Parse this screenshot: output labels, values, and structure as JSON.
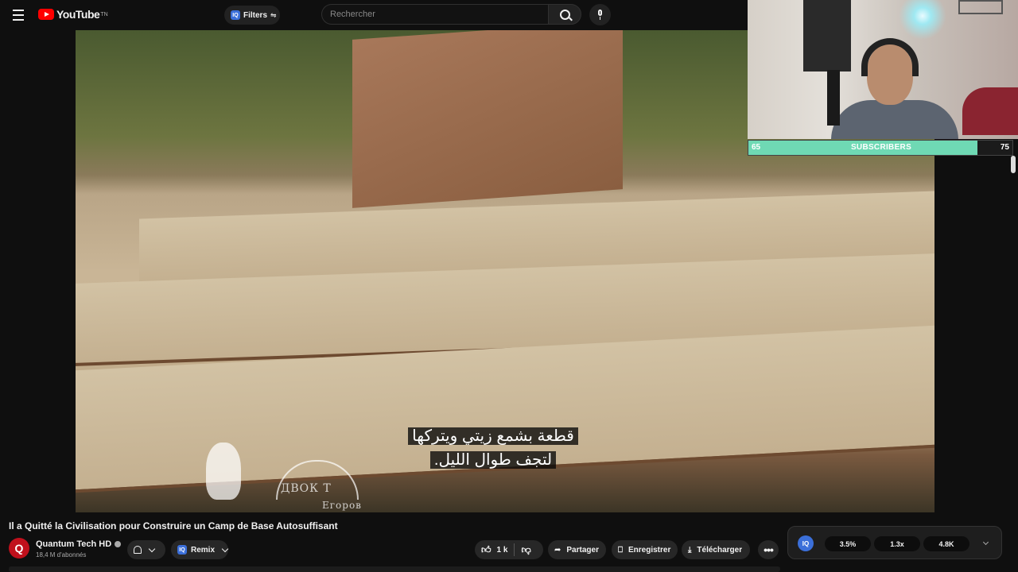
{
  "header": {
    "logo_text": "YouTube",
    "logo_tm": "TN",
    "filters_label": "Filters",
    "filters_badge": "IQ",
    "search_placeholder": "Rechercher"
  },
  "video": {
    "subtitle_line1": "قطعة بشمع زيتي ويتركها",
    "subtitle_line2": "لتجف طوال الليل.",
    "watermark_text": "ДВОК   Т",
    "watermark_name": "Егоров"
  },
  "subscriber_goal": {
    "current": "65",
    "label": "SUBSCRIBERS",
    "target": "75",
    "progress_fraction": 0.867,
    "fill_color": "#6fd9b4"
  },
  "info": {
    "title": "Il a Quitté la Civilisation pour Construire un Camp de Base Autosuffisant",
    "channel_name": "Quantum Tech HD",
    "channel_avatar_letter": "Q",
    "subscribers": "18,4 M d'abonnés",
    "remix_label": "Remix",
    "remix_badge": "IQ",
    "like_count": "1 k",
    "share_label": "Partager",
    "save_label": "Enregistrer",
    "download_label": "Télécharger"
  },
  "iq_panel": {
    "logo": "IQ",
    "stats": [
      "3.5%",
      "1.3x",
      "4.8K"
    ]
  },
  "icons": [
    "menu-icon",
    "youtube-logo",
    "tune-icon",
    "search-icon",
    "mic-icon",
    "bell-icon",
    "chevron-down-icon",
    "thumb-up-icon",
    "thumb-down-icon",
    "share-icon",
    "bookmark-icon",
    "download-icon",
    "more-icon"
  ],
  "colors": {
    "brand_red": "#ff0000",
    "iq_blue": "#3b6fd9",
    "background": "#0f0f0f"
  }
}
